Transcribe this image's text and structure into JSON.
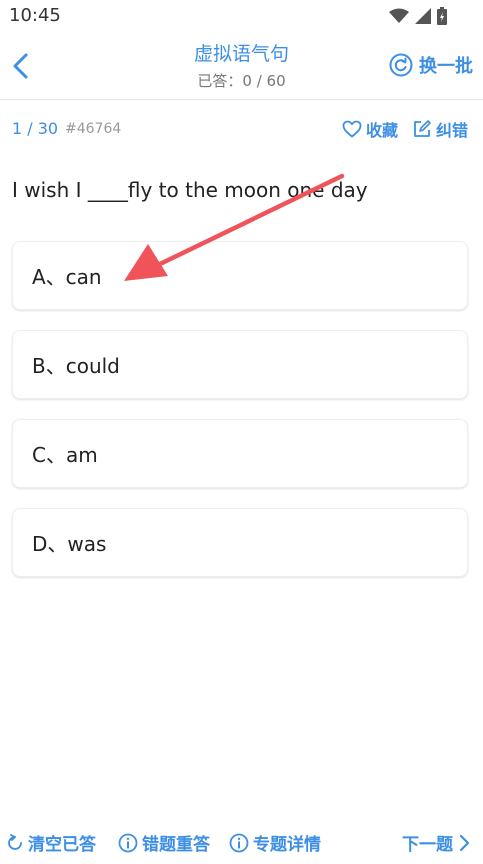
{
  "status_bar": {
    "time": "10:45"
  },
  "header": {
    "title": "虚拟语气句",
    "answered_label": "已答：",
    "answered_value": "0 / 60",
    "swap_label": "换一批"
  },
  "question_meta": {
    "index": "1 / 30",
    "id": "#46764",
    "favorite_label": "收藏",
    "report_label": "纠错"
  },
  "question": {
    "text": "I wish I ____fly to the moon one day",
    "options": [
      {
        "label": "A、can"
      },
      {
        "label": "B、could"
      },
      {
        "label": "C、am"
      },
      {
        "label": "D、was"
      }
    ]
  },
  "bottom_bar": {
    "clear_label": "清空已答",
    "redo_wrong_label": "错题重答",
    "topic_detail_label": "专题详情",
    "next_label": "下一题"
  },
  "colors": {
    "accent": "#3d8fe6",
    "annotation_arrow": "#f0545a"
  }
}
